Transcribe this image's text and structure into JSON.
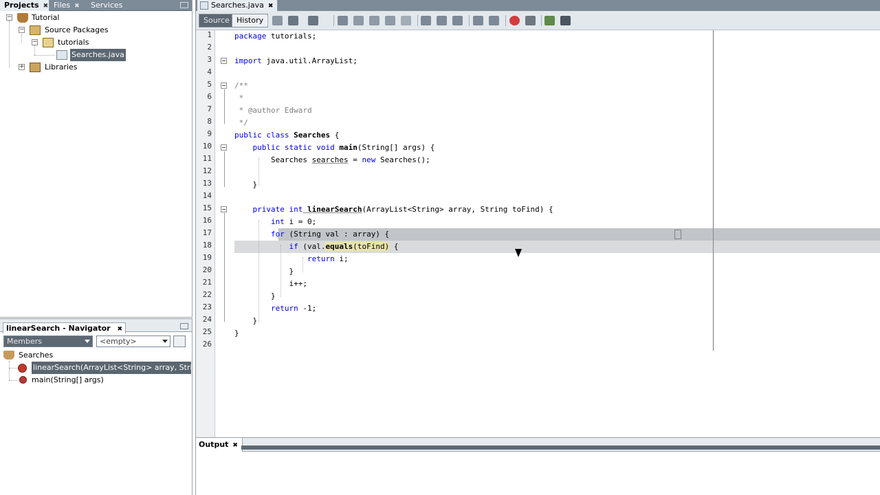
{
  "projects_panel": {
    "tabs": [
      {
        "label": "Projects",
        "close": "✖"
      },
      {
        "label": "Files",
        "close": "✖"
      },
      {
        "label": "Services",
        "close": ""
      }
    ],
    "tree": [
      {
        "label": "Tutorial",
        "depth": 0
      },
      {
        "label": "Source Packages",
        "depth": 1
      },
      {
        "label": "tutorials",
        "depth": 2
      },
      {
        "label": "Searches.java",
        "depth": 3
      },
      {
        "label": "Libraries",
        "depth": 1
      }
    ]
  },
  "navigator": {
    "title": "linearSearch - Navigator",
    "close": "✖",
    "filter_combo": "Members",
    "empty_combo": "<empty>",
    "root": "Searches",
    "members": [
      "linearSearch(ArrayList<String> array, String toFind)",
      "main(String[] args)"
    ]
  },
  "editor": {
    "file_tab": "Searches.java",
    "file_tab_close": "✖",
    "source_tab": "Source",
    "history_tab": "History",
    "line_numbers": [
      "1",
      "2",
      "3",
      "4",
      "5",
      "6",
      "7",
      "8",
      "9",
      "10",
      "11",
      "12",
      "13",
      "14",
      "15",
      "16",
      "17",
      "18",
      "19",
      "20",
      "21",
      "22",
      "23",
      "24",
      "25",
      "26"
    ]
  },
  "code": {
    "l1_kw": "package",
    "l1_rest": " tutorials;",
    "l3_kw": "import",
    "l3_rest": " java.util.ArrayList;",
    "l5": "/**",
    "l6": " *",
    "l7": " * @author Edward",
    "l8": " */",
    "l9_kw": "public class",
    "l9_name": " Searches",
    "l9_rest": " {",
    "l10_kw": "    public static void",
    "l10_fn": " main",
    "l10_rest": "(String[] args) {",
    "l11_a": "        Searches ",
    "l11_var": "searches",
    "l11_b": " = ",
    "l11_kw": "new",
    "l11_c": " Searches();",
    "l13": "    }",
    "l15_kw1": "    private",
    "l15_kw2": " int",
    "l15_fn": " linearSearch",
    "l15_rest": "(ArrayList<String> array, String toFind) {",
    "l16_kw": "        int",
    "l16_rest": " i = 0;",
    "l17_kw": "        for",
    "l17_rest": " (String val : array) {",
    "l18_kw": "            if",
    "l18_a": " (val.",
    "l18_fn": "equals",
    "l18_b": "(toFind)",
    "l18_c": " {",
    "l19_kw": "                return",
    "l19_rest": " i;",
    "l20": "            }",
    "l21": "            i++;",
    "l22": "        }",
    "l23_kw": "        return",
    "l23_rest": " -1;",
    "l24": "    }",
    "l25": "}"
  },
  "output": {
    "tab": "Output",
    "close": "✖"
  }
}
